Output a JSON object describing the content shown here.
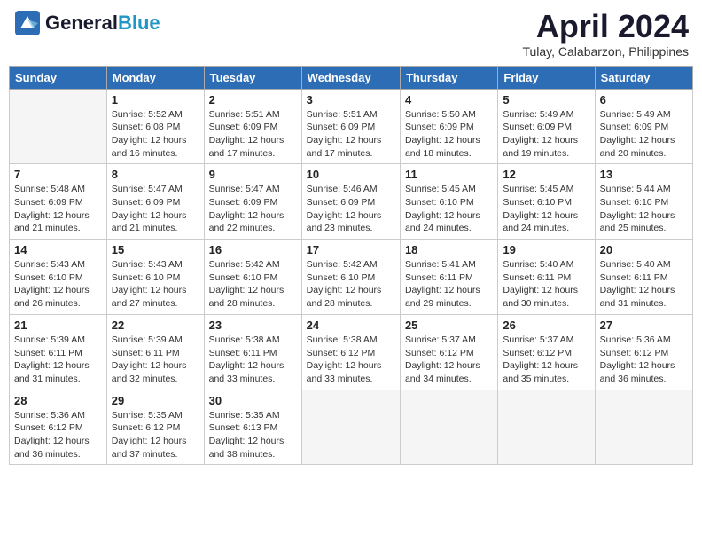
{
  "header": {
    "logo_line1": "General",
    "logo_line2": "Blue",
    "month": "April 2024",
    "location": "Tulay, Calabarzon, Philippines"
  },
  "weekdays": [
    "Sunday",
    "Monday",
    "Tuesday",
    "Wednesday",
    "Thursday",
    "Friday",
    "Saturday"
  ],
  "weeks": [
    [
      {
        "day": "",
        "sunrise": "",
        "sunset": "",
        "daylight": ""
      },
      {
        "day": "1",
        "sunrise": "Sunrise: 5:52 AM",
        "sunset": "Sunset: 6:08 PM",
        "daylight": "Daylight: 12 hours and 16 minutes."
      },
      {
        "day": "2",
        "sunrise": "Sunrise: 5:51 AM",
        "sunset": "Sunset: 6:09 PM",
        "daylight": "Daylight: 12 hours and 17 minutes."
      },
      {
        "day": "3",
        "sunrise": "Sunrise: 5:51 AM",
        "sunset": "Sunset: 6:09 PM",
        "daylight": "Daylight: 12 hours and 17 minutes."
      },
      {
        "day": "4",
        "sunrise": "Sunrise: 5:50 AM",
        "sunset": "Sunset: 6:09 PM",
        "daylight": "Daylight: 12 hours and 18 minutes."
      },
      {
        "day": "5",
        "sunrise": "Sunrise: 5:49 AM",
        "sunset": "Sunset: 6:09 PM",
        "daylight": "Daylight: 12 hours and 19 minutes."
      },
      {
        "day": "6",
        "sunrise": "Sunrise: 5:49 AM",
        "sunset": "Sunset: 6:09 PM",
        "daylight": "Daylight: 12 hours and 20 minutes."
      }
    ],
    [
      {
        "day": "7",
        "sunrise": "Sunrise: 5:48 AM",
        "sunset": "Sunset: 6:09 PM",
        "daylight": "Daylight: 12 hours and 21 minutes."
      },
      {
        "day": "8",
        "sunrise": "Sunrise: 5:47 AM",
        "sunset": "Sunset: 6:09 PM",
        "daylight": "Daylight: 12 hours and 21 minutes."
      },
      {
        "day": "9",
        "sunrise": "Sunrise: 5:47 AM",
        "sunset": "Sunset: 6:09 PM",
        "daylight": "Daylight: 12 hours and 22 minutes."
      },
      {
        "day": "10",
        "sunrise": "Sunrise: 5:46 AM",
        "sunset": "Sunset: 6:09 PM",
        "daylight": "Daylight: 12 hours and 23 minutes."
      },
      {
        "day": "11",
        "sunrise": "Sunrise: 5:45 AM",
        "sunset": "Sunset: 6:10 PM",
        "daylight": "Daylight: 12 hours and 24 minutes."
      },
      {
        "day": "12",
        "sunrise": "Sunrise: 5:45 AM",
        "sunset": "Sunset: 6:10 PM",
        "daylight": "Daylight: 12 hours and 24 minutes."
      },
      {
        "day": "13",
        "sunrise": "Sunrise: 5:44 AM",
        "sunset": "Sunset: 6:10 PM",
        "daylight": "Daylight: 12 hours and 25 minutes."
      }
    ],
    [
      {
        "day": "14",
        "sunrise": "Sunrise: 5:43 AM",
        "sunset": "Sunset: 6:10 PM",
        "daylight": "Daylight: 12 hours and 26 minutes."
      },
      {
        "day": "15",
        "sunrise": "Sunrise: 5:43 AM",
        "sunset": "Sunset: 6:10 PM",
        "daylight": "Daylight: 12 hours and 27 minutes."
      },
      {
        "day": "16",
        "sunrise": "Sunrise: 5:42 AM",
        "sunset": "Sunset: 6:10 PM",
        "daylight": "Daylight: 12 hours and 28 minutes."
      },
      {
        "day": "17",
        "sunrise": "Sunrise: 5:42 AM",
        "sunset": "Sunset: 6:10 PM",
        "daylight": "Daylight: 12 hours and 28 minutes."
      },
      {
        "day": "18",
        "sunrise": "Sunrise: 5:41 AM",
        "sunset": "Sunset: 6:11 PM",
        "daylight": "Daylight: 12 hours and 29 minutes."
      },
      {
        "day": "19",
        "sunrise": "Sunrise: 5:40 AM",
        "sunset": "Sunset: 6:11 PM",
        "daylight": "Daylight: 12 hours and 30 minutes."
      },
      {
        "day": "20",
        "sunrise": "Sunrise: 5:40 AM",
        "sunset": "Sunset: 6:11 PM",
        "daylight": "Daylight: 12 hours and 31 minutes."
      }
    ],
    [
      {
        "day": "21",
        "sunrise": "Sunrise: 5:39 AM",
        "sunset": "Sunset: 6:11 PM",
        "daylight": "Daylight: 12 hours and 31 minutes."
      },
      {
        "day": "22",
        "sunrise": "Sunrise: 5:39 AM",
        "sunset": "Sunset: 6:11 PM",
        "daylight": "Daylight: 12 hours and 32 minutes."
      },
      {
        "day": "23",
        "sunrise": "Sunrise: 5:38 AM",
        "sunset": "Sunset: 6:11 PM",
        "daylight": "Daylight: 12 hours and 33 minutes."
      },
      {
        "day": "24",
        "sunrise": "Sunrise: 5:38 AM",
        "sunset": "Sunset: 6:12 PM",
        "daylight": "Daylight: 12 hours and 33 minutes."
      },
      {
        "day": "25",
        "sunrise": "Sunrise: 5:37 AM",
        "sunset": "Sunset: 6:12 PM",
        "daylight": "Daylight: 12 hours and 34 minutes."
      },
      {
        "day": "26",
        "sunrise": "Sunrise: 5:37 AM",
        "sunset": "Sunset: 6:12 PM",
        "daylight": "Daylight: 12 hours and 35 minutes."
      },
      {
        "day": "27",
        "sunrise": "Sunrise: 5:36 AM",
        "sunset": "Sunset: 6:12 PM",
        "daylight": "Daylight: 12 hours and 36 minutes."
      }
    ],
    [
      {
        "day": "28",
        "sunrise": "Sunrise: 5:36 AM",
        "sunset": "Sunset: 6:12 PM",
        "daylight": "Daylight: 12 hours and 36 minutes."
      },
      {
        "day": "29",
        "sunrise": "Sunrise: 5:35 AM",
        "sunset": "Sunset: 6:12 PM",
        "daylight": "Daylight: 12 hours and 37 minutes."
      },
      {
        "day": "30",
        "sunrise": "Sunrise: 5:35 AM",
        "sunset": "Sunset: 6:13 PM",
        "daylight": "Daylight: 12 hours and 38 minutes."
      },
      {
        "day": "",
        "sunrise": "",
        "sunset": "",
        "daylight": ""
      },
      {
        "day": "",
        "sunrise": "",
        "sunset": "",
        "daylight": ""
      },
      {
        "day": "",
        "sunrise": "",
        "sunset": "",
        "daylight": ""
      },
      {
        "day": "",
        "sunrise": "",
        "sunset": "",
        "daylight": ""
      }
    ]
  ]
}
